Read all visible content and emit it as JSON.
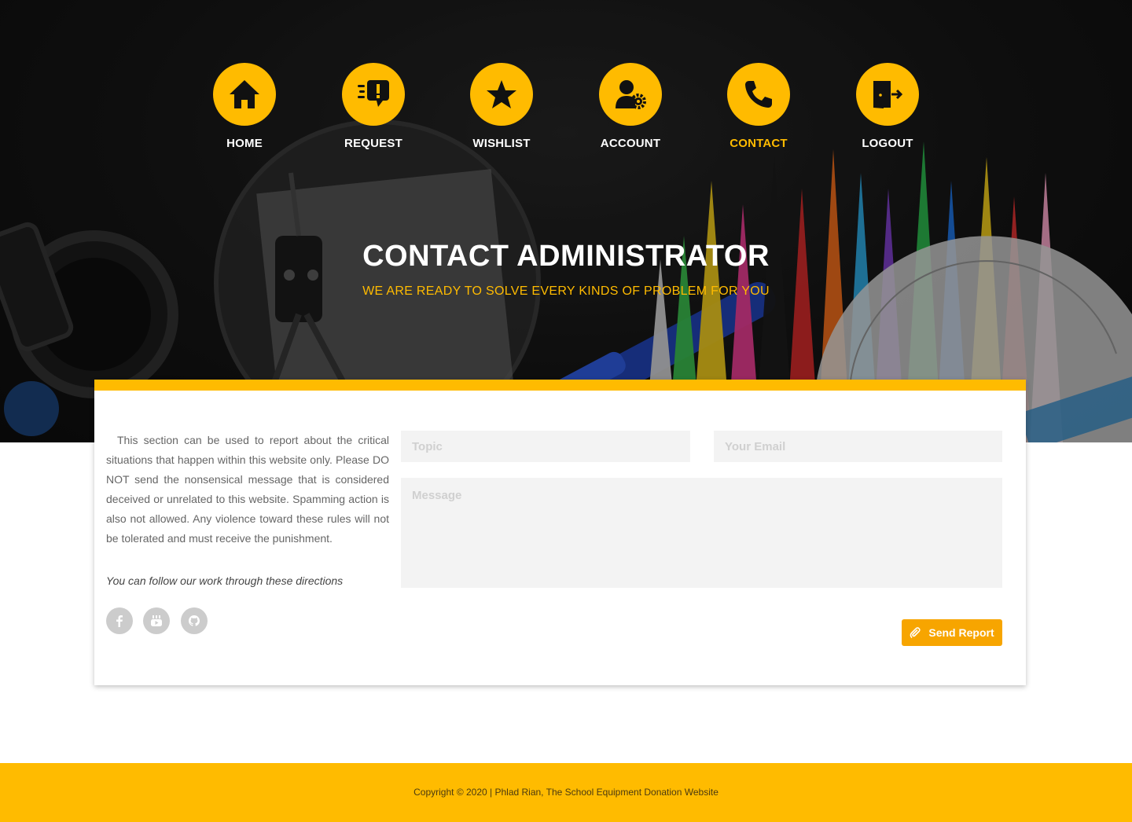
{
  "nav": {
    "items": [
      {
        "label": "HOME",
        "icon": "home-icon"
      },
      {
        "label": "REQUEST",
        "icon": "request-icon"
      },
      {
        "label": "WISHLIST",
        "icon": "star-icon"
      },
      {
        "label": "ACCOUNT",
        "icon": "user-gear-icon"
      },
      {
        "label": "CONTACT",
        "icon": "phone-icon",
        "active": true
      },
      {
        "label": "LOGOUT",
        "icon": "logout-door-icon"
      }
    ]
  },
  "hero": {
    "title": "CONTACT ADMINISTRATOR",
    "subtitle": "WE ARE READY TO SOLVE EVERY KINDS OF PROBLEM FOR YOU"
  },
  "contact": {
    "description": "This section can be used to report about the critical situations that happen within this website only. Please DO NOT send the nonsensical message that is considered deceived or unrelated to this website. Spamming action is also not allowed. Any violence toward these rules will not be tolerated and must receive the punishment.",
    "follow_text": "You can follow our work through these directions",
    "socials": [
      "facebook-icon",
      "youtube-icon",
      "github-icon"
    ],
    "form": {
      "topic_placeholder": "Topic",
      "email_placeholder": "Your Email",
      "message_placeholder": "Message",
      "topic_value": "",
      "email_value": "",
      "message_value": "",
      "send_label": "Send Report"
    }
  },
  "footer": {
    "copyright": "Copyright © 2020 | Phlad Rian, The School Equipment Donation Website"
  },
  "colors": {
    "accent": "#ffbb00",
    "button": "#f7a500",
    "hero_bg": "#141414"
  }
}
